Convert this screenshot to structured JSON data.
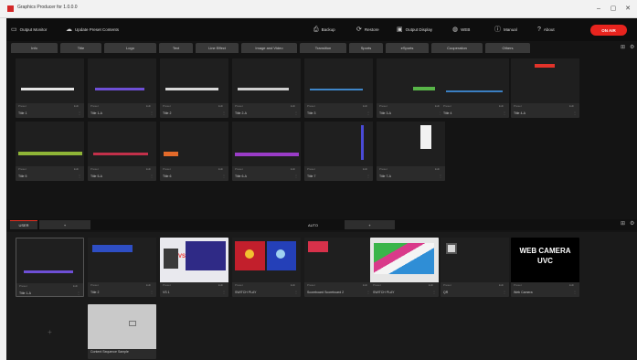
{
  "window": {
    "title": "Graphics Producer for 1.0.0.0",
    "minimize_glyph": "–",
    "maximize_glyph": "▢",
    "close_glyph": "✕"
  },
  "topbar": {
    "output_monitor": "Output Monitor",
    "update_contents": "Update Preset Contents",
    "backup": "Backup",
    "restore": "Restore",
    "output_display": "Output Display",
    "web": "WEB",
    "manual": "Manual",
    "about": "About",
    "on_air": "ON AIR"
  },
  "icons": {
    "monitor": "monitor-icon",
    "cloud": "cloud-download-icon",
    "backup": "backup-icon",
    "restore": "restore-icon",
    "display": "display-icon",
    "web": "globe-icon",
    "manual": "info-icon",
    "about": "question-icon"
  },
  "tabs": [
    "Info",
    "Title",
    "Logo",
    "Text",
    "Line Effect",
    "Image and Video",
    "Transition",
    "Sports",
    "eSports",
    "Cooperation",
    "Others"
  ],
  "grid_controls": {
    "grid_glyph": "⊞",
    "settings_glyph": "⚙"
  },
  "tiles": [
    {
      "name": "Title 1",
      "meta": "Preset",
      "meta2": "Edit"
    },
    {
      "name": "Title 1-A",
      "meta": "Preset",
      "meta2": "Edit"
    },
    {
      "name": "Title 2",
      "meta": "Preset",
      "meta2": "Edit"
    },
    {
      "name": "Title 2-A",
      "meta": "Preset",
      "meta2": "Edit"
    },
    {
      "name": "Title 3",
      "meta": "Preset",
      "meta2": "Edit"
    },
    {
      "name": "Title 3-A",
      "meta": "Preset",
      "meta2": "Edit"
    },
    {
      "name": "Title 4",
      "meta": "Preset",
      "meta2": "Edit"
    },
    {
      "name": "Title 4-A",
      "meta": "Preset",
      "meta2": "Edit"
    },
    {
      "name": "Title 5",
      "meta": "Preset",
      "meta2": "Edit"
    },
    {
      "name": "Title 5-A",
      "meta": "Preset",
      "meta2": "Edit"
    },
    {
      "name": "Title 6",
      "meta": "Preset",
      "meta2": "Edit"
    },
    {
      "name": "Title 6-A",
      "meta": "Preset",
      "meta2": "Edit"
    },
    {
      "name": "Title 7",
      "meta": "Preset",
      "meta2": "Edit"
    },
    {
      "name": "Title 7-A",
      "meta": "Preset",
      "meta2": "Edit"
    }
  ],
  "lower_tabs": {
    "user": "USER",
    "add": "+",
    "auto": "AUTO",
    "auto_plus": "+"
  },
  "user_tiles": [
    {
      "name": "Title 1-A",
      "meta": "Preset",
      "meta2": "Edit"
    },
    {
      "name": "Title 2",
      "meta": "Preset",
      "meta2": "Edit"
    },
    {
      "name": "VS 1",
      "meta": "Preset",
      "meta2": "Edit"
    },
    {
      "name": "SWITCH PLAY",
      "meta": "Preset",
      "meta2": "Edit"
    },
    {
      "name": "Scoreboard Scoreboard 2",
      "meta": "Preset",
      "meta2": "Edit"
    },
    {
      "name": "SWITCH PLAY",
      "meta": "Preset",
      "meta2": "Edit"
    },
    {
      "name": "QR",
      "meta": "Preset",
      "meta2": "Edit"
    },
    {
      "name": "Web Camera",
      "meta": "Preset",
      "meta2": "Edit"
    },
    {
      "name": "Content Sequence Sample",
      "meta": "",
      "meta2": ""
    }
  ],
  "web_camera": {
    "line1": "WEB CAMERA",
    "line2": "UVC"
  },
  "vs_badge": "VS",
  "empty_slot_glyph": "+",
  "colors": {
    "accent": "#e8241e",
    "bg": "#141414",
    "tile": "#2b2b2b"
  }
}
